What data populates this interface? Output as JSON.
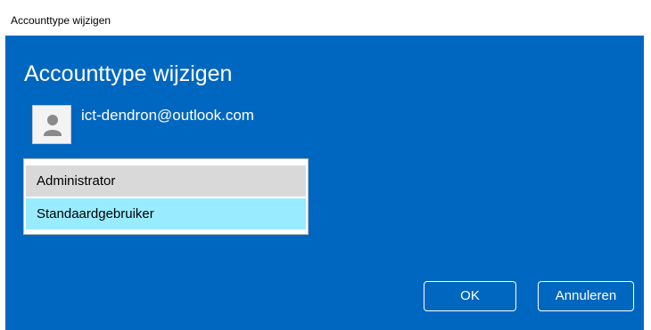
{
  "window": {
    "title": "Accounttype wijzigen"
  },
  "dialog": {
    "heading": "Accounttype wijzigen",
    "account_email": "ict-dendron@outlook.com",
    "avatar_icon": "user-avatar-icon",
    "account_types": [
      {
        "label": "Administrator",
        "state": "highlighted"
      },
      {
        "label": "Standaardgebruiker",
        "state": "selected"
      }
    ],
    "buttons": {
      "ok": "OK",
      "cancel": "Annuleren"
    }
  },
  "colors": {
    "dialog_background": "#0067c0",
    "selected_option": "#99ebff",
    "highlighted_option": "#d9d9d9"
  }
}
